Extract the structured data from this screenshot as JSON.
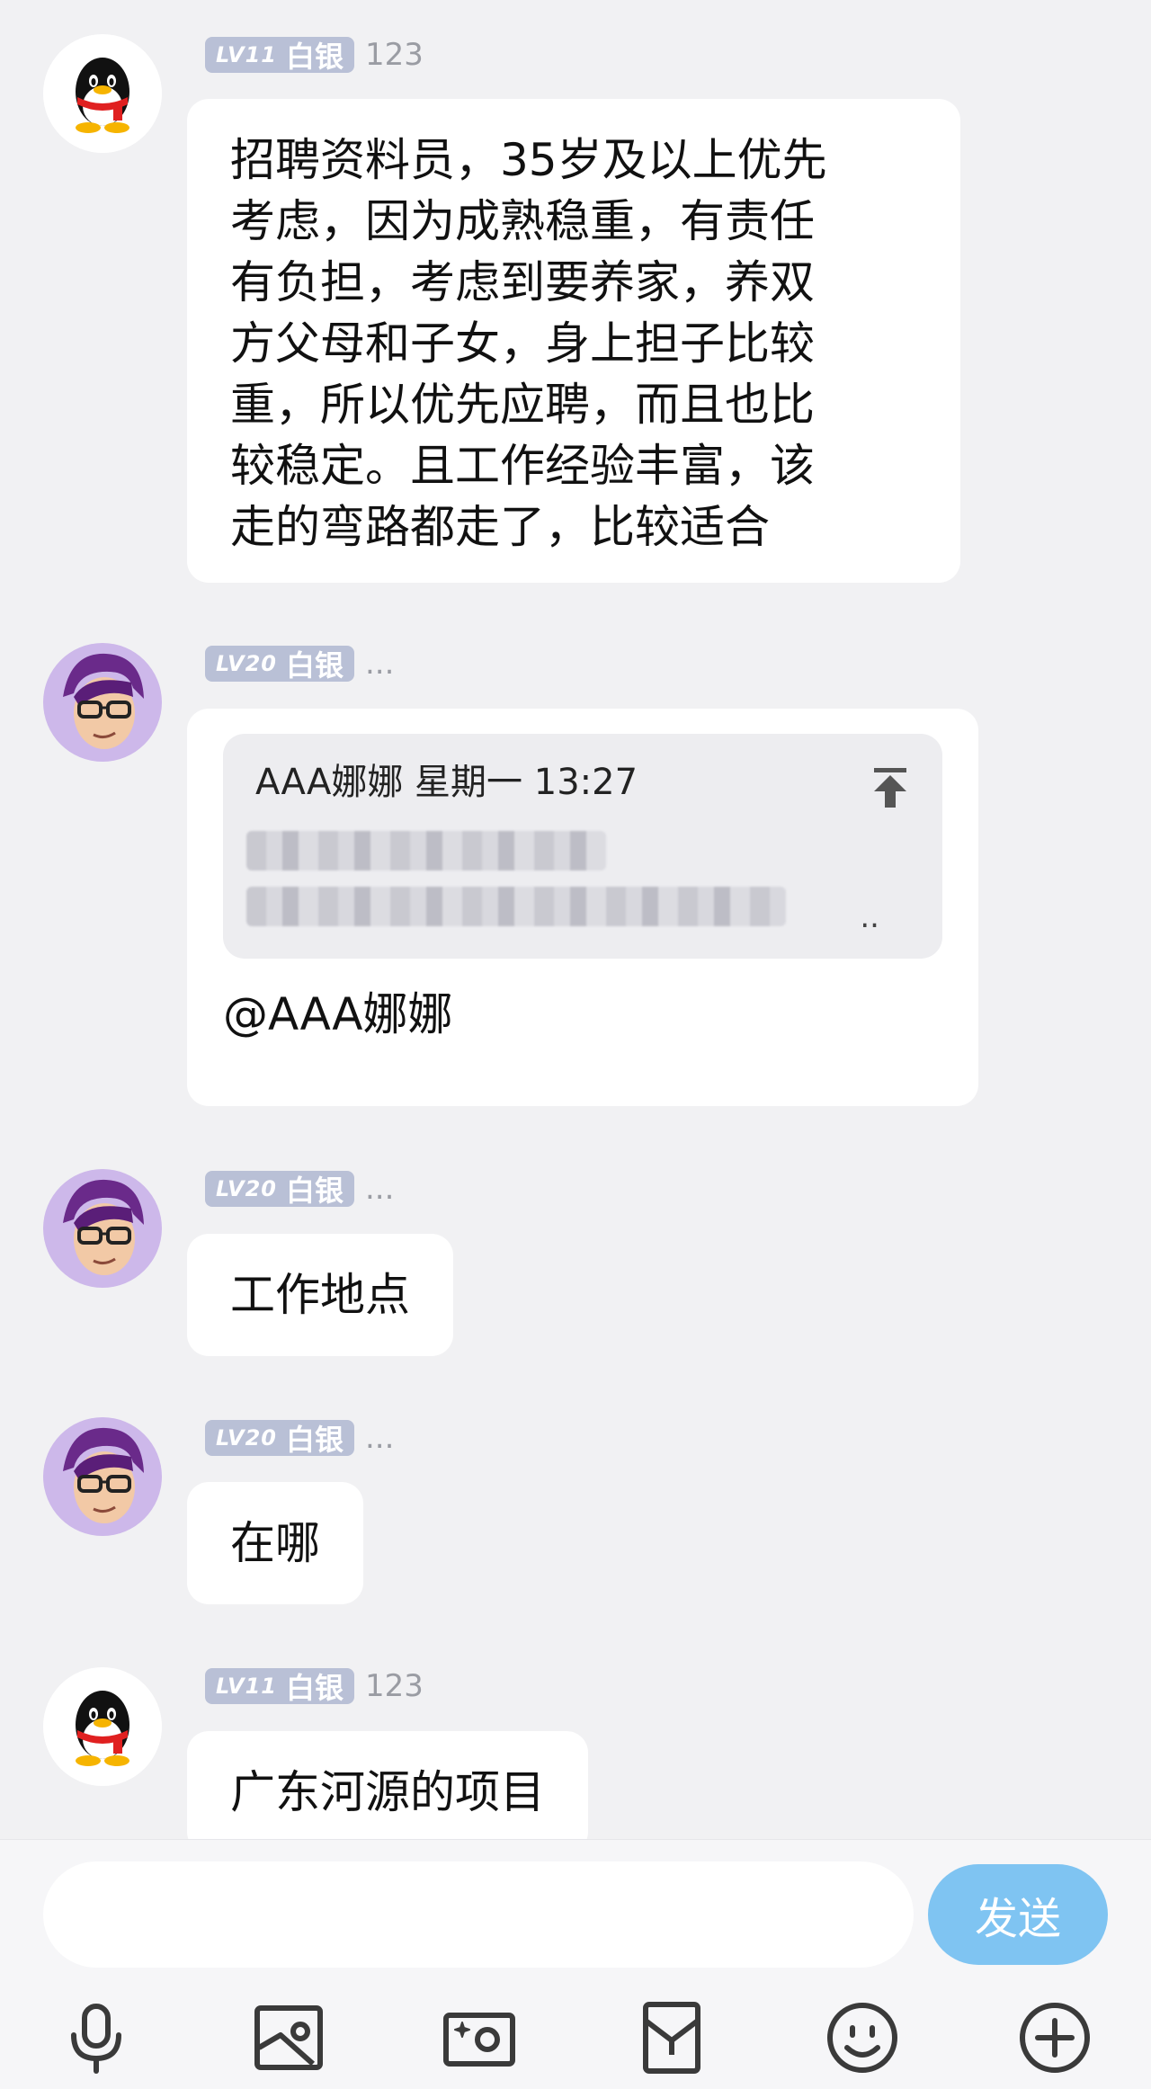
{
  "messages": [
    {
      "level": "LV11",
      "rank": "白银",
      "nick": "123",
      "lines": [
        "招聘资料员，35岁及以上优先",
        "考虑，因为成熟稳重，有责任",
        "有负担，考虑到要养家，养双",
        "方父母和子女，身上担子比较",
        "重，所以优先应聘，而且也比",
        "较稳定。且工作经验丰富，该",
        "走的弯路都走了，比较适合"
      ]
    },
    {
      "level": "LV20",
      "rank": "白银",
      "nick": "...",
      "reply": {
        "author_time": "AAA娜娜  星期一 13:27",
        "dots": ".."
      },
      "mention": "@AAA娜娜"
    },
    {
      "level": "LV20",
      "rank": "白银",
      "nick": "...",
      "text": "工作地点"
    },
    {
      "level": "LV20",
      "rank": "白银",
      "nick": "...",
      "text": "在哪"
    },
    {
      "level": "LV11",
      "rank": "白银",
      "nick": "123",
      "text": "广东河源的项目"
    }
  ],
  "input": {
    "placeholder": "",
    "send_label": "发送"
  },
  "toolbar": [
    "microphone-icon",
    "gallery-icon",
    "camera-icon",
    "red-packet-icon",
    "emoji-icon",
    "plus-icon"
  ],
  "colors": {
    "badge": "#b9c0d6",
    "send": "#7fc4f2",
    "background": "#f1f1f3"
  }
}
